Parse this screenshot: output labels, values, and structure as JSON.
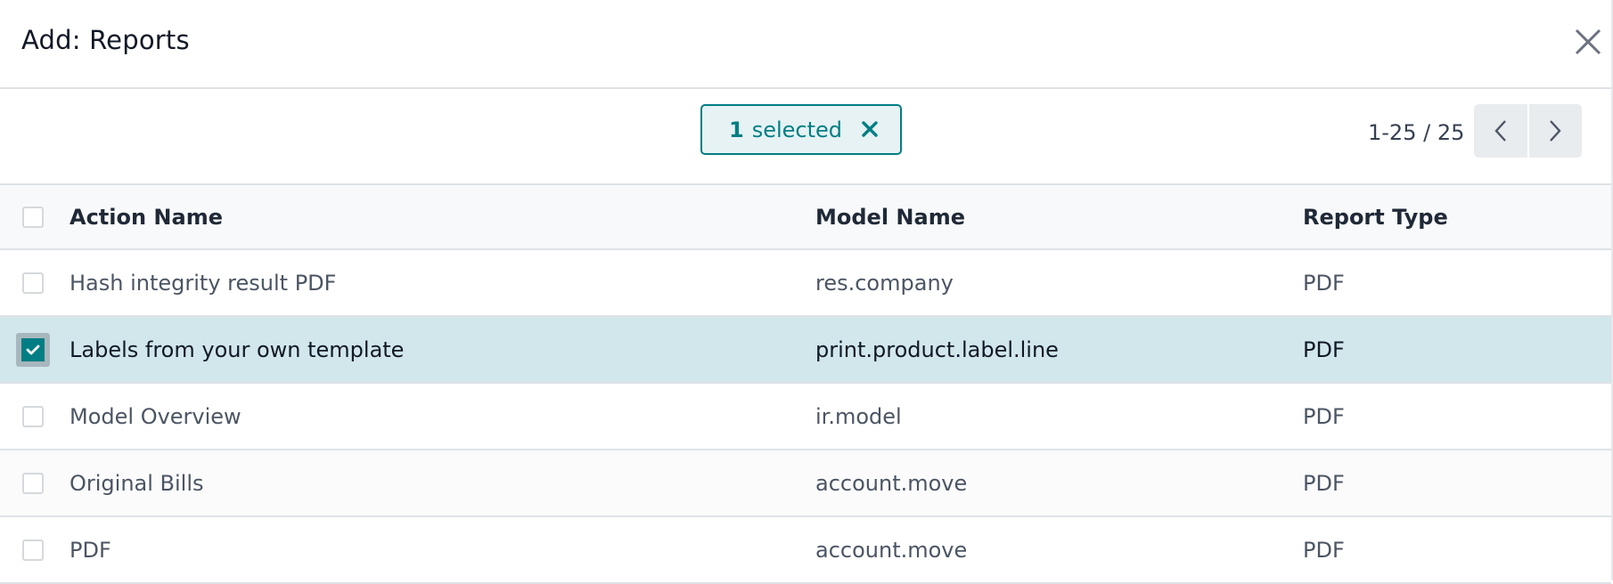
{
  "dialog": {
    "title": "Add: Reports",
    "close_icon": "close-icon"
  },
  "selection": {
    "count": "1",
    "label": "selected",
    "clear_icon": "close-icon",
    "accent_color": "#017e84"
  },
  "pager": {
    "value": "1-25 / 25",
    "prev_icon": "chevron-left-icon",
    "next_icon": "chevron-right-icon"
  },
  "table": {
    "columns": [
      "Action Name",
      "Model Name",
      "Report Type"
    ],
    "rows": [
      {
        "action_name": "Hash integrity result PDF",
        "model_name": "res.company",
        "report_type": "PDF",
        "checked": false
      },
      {
        "action_name": "Labels from your own template",
        "model_name": "print.product.label.line",
        "report_type": "PDF",
        "checked": true
      },
      {
        "action_name": "Model Overview",
        "model_name": "ir.model",
        "report_type": "PDF",
        "checked": false
      },
      {
        "action_name": "Original Bills",
        "model_name": "account.move",
        "report_type": "PDF",
        "checked": false
      },
      {
        "action_name": "PDF",
        "model_name": "account.move",
        "report_type": "PDF",
        "checked": false
      }
    ]
  }
}
